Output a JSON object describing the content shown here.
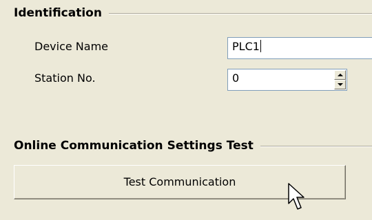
{
  "identification": {
    "title": "Identification",
    "device_name_label": "Device Name",
    "device_name_value": "PLC1",
    "station_no_label": "Station No.",
    "station_no_value": "0"
  },
  "online_test": {
    "title": "Online Communication Settings Test",
    "button_label": "Test Communication"
  },
  "icons": {
    "spin_up": "spin-up-arrow",
    "spin_down": "spin-down-arrow",
    "cursor": "mouse-pointer"
  }
}
